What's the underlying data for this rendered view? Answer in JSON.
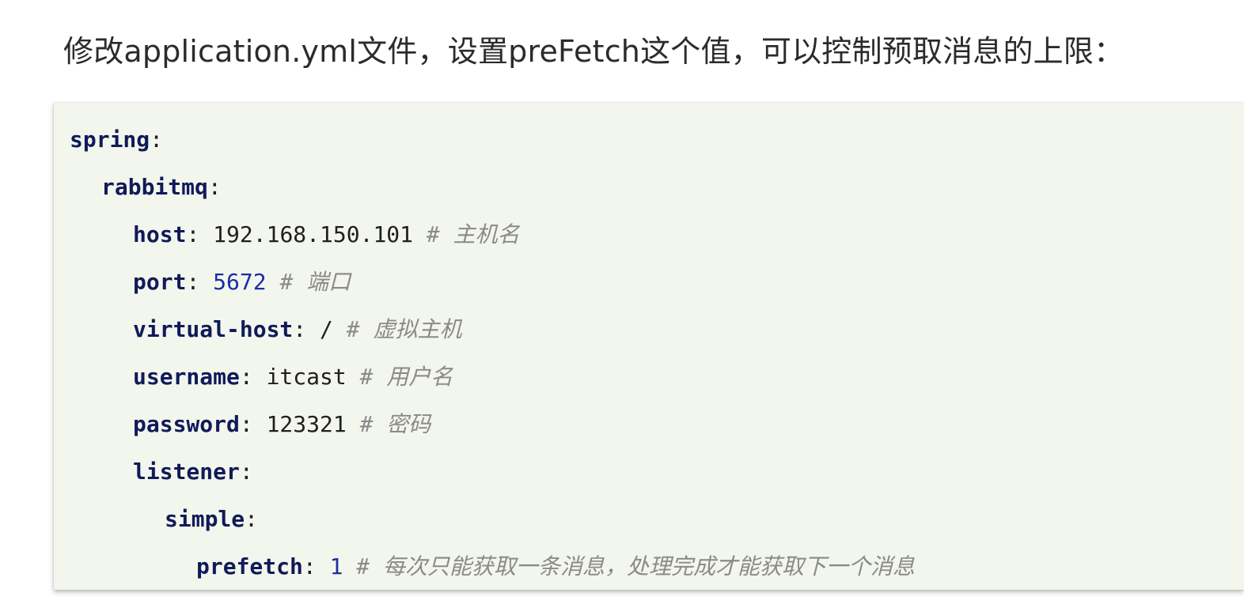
{
  "intro_text": "修改application.yml文件，设置preFetch这个值，可以控制预取消息的上限：",
  "code": {
    "lines": [
      {
        "indent": 0,
        "key": "spring",
        "sep": ":",
        "value": "",
        "value_type": "none",
        "comment": ""
      },
      {
        "indent": 1,
        "key": "rabbitmq",
        "sep": ":",
        "value": "",
        "value_type": "none",
        "comment": ""
      },
      {
        "indent": 2,
        "key": "host",
        "sep": ": ",
        "value": "192.168.150.101",
        "value_type": "string",
        "comment": " # 主机名"
      },
      {
        "indent": 2,
        "key": "port",
        "sep": ": ",
        "value": "5672",
        "value_type": "number",
        "comment": " # 端口"
      },
      {
        "indent": 2,
        "key": "virtual-host",
        "sep": ": ",
        "value": "/",
        "value_type": "string",
        "comment": " # 虚拟主机"
      },
      {
        "indent": 2,
        "key": "username",
        "sep": ": ",
        "value": "itcast",
        "value_type": "string",
        "comment": " # 用户名"
      },
      {
        "indent": 2,
        "key": "password",
        "sep": ": ",
        "value": "123321",
        "value_type": "string",
        "comment": " # 密码"
      },
      {
        "indent": 2,
        "key": "listener",
        "sep": ":",
        "value": "",
        "value_type": "none",
        "comment": ""
      },
      {
        "indent": 3,
        "key": "simple",
        "sep": ":",
        "value": "",
        "value_type": "none",
        "comment": ""
      },
      {
        "indent": 4,
        "key": "prefetch",
        "sep": ": ",
        "value": "1",
        "value_type": "number",
        "comment": " # 每次只能获取一条消息，处理完成才能获取下一个消息"
      }
    ]
  },
  "colors": {
    "key": "#101a5a",
    "number": "#1b2ca8",
    "comment": "#8a8a8a",
    "code_background": "#f3f6ec"
  }
}
